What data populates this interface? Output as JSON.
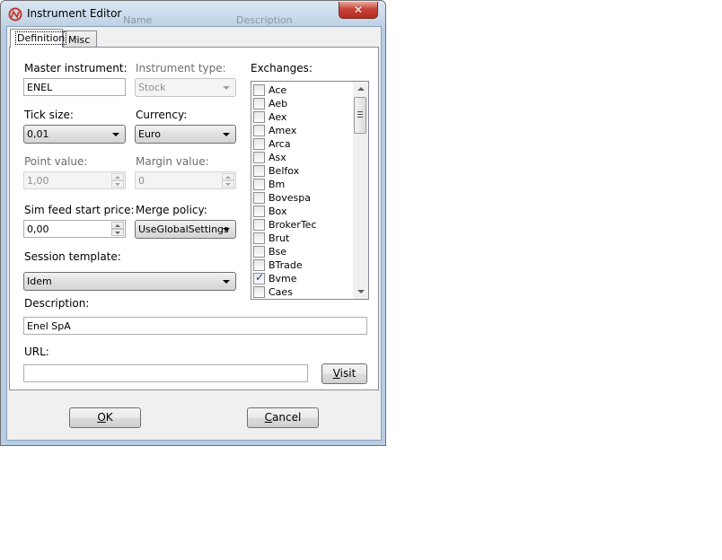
{
  "window": {
    "title": "Instrument Editor",
    "ghost_headers": [
      "Name",
      "Description"
    ],
    "close_glyph": "✕"
  },
  "tabs": [
    "Definition",
    "Misc"
  ],
  "form": {
    "master_instrument": {
      "label": "Master instrument:",
      "value": "ENEL"
    },
    "instrument_type": {
      "label": "Instrument type:",
      "value": "Stock"
    },
    "tick_size": {
      "label": "Tick size:",
      "value": "0,01"
    },
    "currency": {
      "label": "Currency:",
      "value": "Euro"
    },
    "point_value": {
      "label": "Point value:",
      "value": "1,00"
    },
    "margin_value": {
      "label": "Margin value:",
      "value": "0"
    },
    "sim_feed_start_price": {
      "label": "Sim feed start price:",
      "value": "0,00"
    },
    "merge_policy": {
      "label": "Merge policy:",
      "value": "UseGlobalSettings"
    },
    "session_template": {
      "label": "Session template:",
      "value": "Idem"
    },
    "description": {
      "label": "Description:",
      "value": "Enel SpA"
    },
    "url": {
      "label": "URL:",
      "value": ""
    }
  },
  "exchanges": {
    "label": "Exchanges:",
    "items": [
      {
        "name": "Ace",
        "checked": false
      },
      {
        "name": "Aeb",
        "checked": false
      },
      {
        "name": "Aex",
        "checked": false
      },
      {
        "name": "Amex",
        "checked": false
      },
      {
        "name": "Arca",
        "checked": false
      },
      {
        "name": "Asx",
        "checked": false
      },
      {
        "name": "Belfox",
        "checked": false
      },
      {
        "name": "Bm",
        "checked": false
      },
      {
        "name": "Bovespa",
        "checked": false
      },
      {
        "name": "Box",
        "checked": false
      },
      {
        "name": "BrokerTec",
        "checked": false
      },
      {
        "name": "Brut",
        "checked": false
      },
      {
        "name": "Bse",
        "checked": false
      },
      {
        "name": "BTrade",
        "checked": false
      },
      {
        "name": "Bvme",
        "checked": true
      },
      {
        "name": "Caes",
        "checked": false
      }
    ]
  },
  "buttons": {
    "visit": {
      "mnemonic": "V",
      "rest": "isit"
    },
    "ok": {
      "mnemonic": "O",
      "rest": "K"
    },
    "cancel": {
      "mnemonic": "C",
      "rest": "ancel"
    }
  },
  "colors": {
    "frame": "#b7cde3",
    "close_button": "#c7443a",
    "checkmark": "#1f3e7a"
  },
  "icons": {
    "app": "ninja-logo-icon",
    "close": "close-icon",
    "dropdown": "chevron-down-icon",
    "spinner": "spinner-arrows-icon",
    "checkbox": "checkbox-icon"
  }
}
